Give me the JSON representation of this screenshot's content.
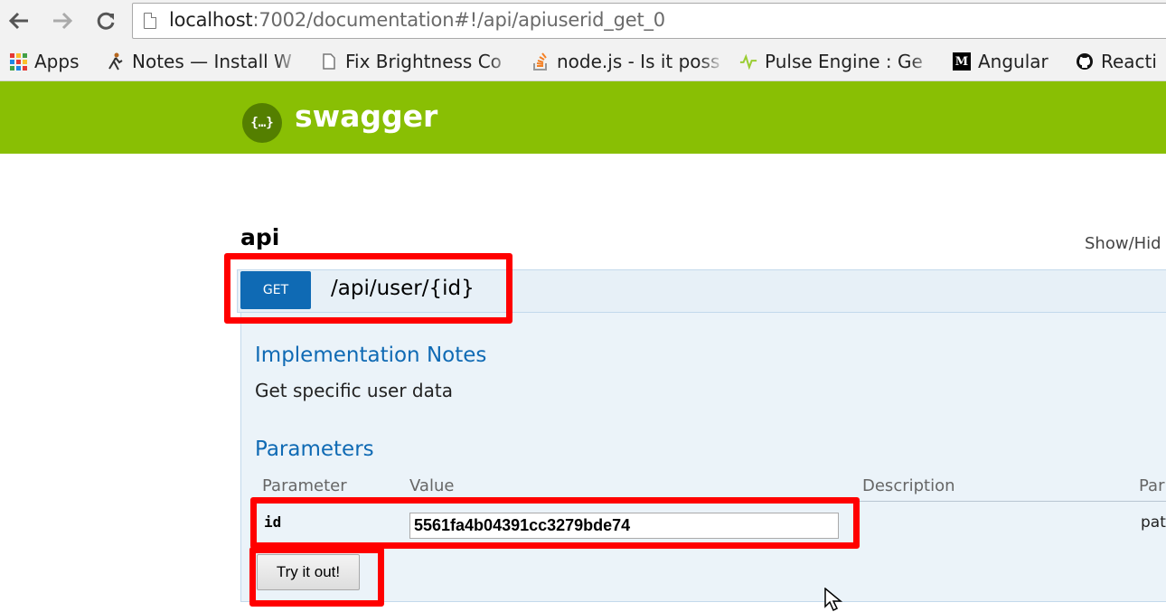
{
  "browser": {
    "url_host": "localhost",
    "url_rest": ":7002/documentation#!/api/apiuserid_get_0",
    "bookmarks": [
      {
        "label": "Apps",
        "icon": "apps-grid-icon"
      },
      {
        "label": "Notes — Install W",
        "icon": "notes-figure-icon"
      },
      {
        "label": "Fix Brightness Co",
        "icon": "page-icon"
      },
      {
        "label": "node.js - Is it poss",
        "icon": "stack-overflow-icon"
      },
      {
        "label": "Pulse Engine : Ge",
        "icon": "pulse-icon"
      },
      {
        "label": "Angular",
        "icon": "medium-icon"
      },
      {
        "label": "Reacti",
        "icon": "github-icon"
      }
    ]
  },
  "header": {
    "logo_glyph": "{…}",
    "title": "swagger"
  },
  "api": {
    "section_title": "api",
    "show_hide": "Show/Hid",
    "method": "GET",
    "path": "/api/user/{id}",
    "implementation_notes_title": "Implementation Notes",
    "implementation_notes": "Get specific user data",
    "parameters_title": "Parameters",
    "columns": [
      "Parameter",
      "Value",
      "Description",
      "Par"
    ],
    "param": {
      "name": "id",
      "value": "5561fa4b04391cc3279bde74",
      "type": "pat"
    },
    "try_label": "Try it out!"
  },
  "colors": {
    "swagger_green": "#89bf04",
    "get_blue": "#0f6ab4",
    "highlight_red": "#ff0000"
  }
}
